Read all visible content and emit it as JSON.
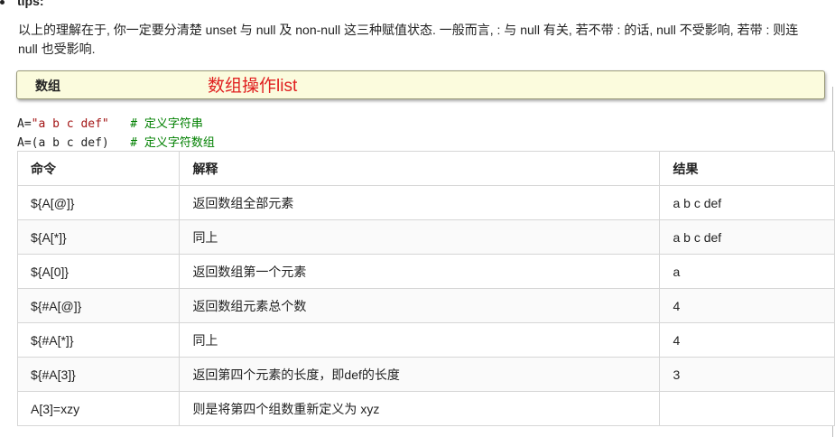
{
  "tips": {
    "heading": "tips:",
    "text": "以上的理解在于, 你一定要分清楚 unset 与 null 及 non-null 这三种赋值状态. 一般而言, : 与 null 有关, 若不带 : 的话, null 不受影响, 若带 : 则连 null 也受影响."
  },
  "panel": {
    "title": "数组",
    "annotation": "数组操作list",
    "annotation_color": "#e02020"
  },
  "code": {
    "line1": {
      "prefix": "A=",
      "string": "\"a b c def\"",
      "comment": "# 定义字符串"
    },
    "line2": {
      "prefix": "A=(a b c def)",
      "comment": "# 定义字符数组"
    }
  },
  "table": {
    "headers": [
      "命令",
      "解释",
      "结果"
    ],
    "rows": [
      [
        "${A[@]}",
        "返回数组全部元素",
        "a b c def"
      ],
      [
        "${A[*]}",
        "同上",
        "a b c def"
      ],
      [
        "${A[0]}",
        "返回数组第一个元素",
        "a"
      ],
      [
        "${#A[@]}",
        "返回数组元素总个数",
        "4"
      ],
      [
        "${#A[*]}",
        "同上",
        "4"
      ],
      [
        "${#A[3]}",
        "返回第四个元素的长度，即def的长度",
        "3"
      ],
      [
        "A[3]=xzy",
        "则是将第四个组数重新定义为 xyz",
        ""
      ]
    ]
  }
}
